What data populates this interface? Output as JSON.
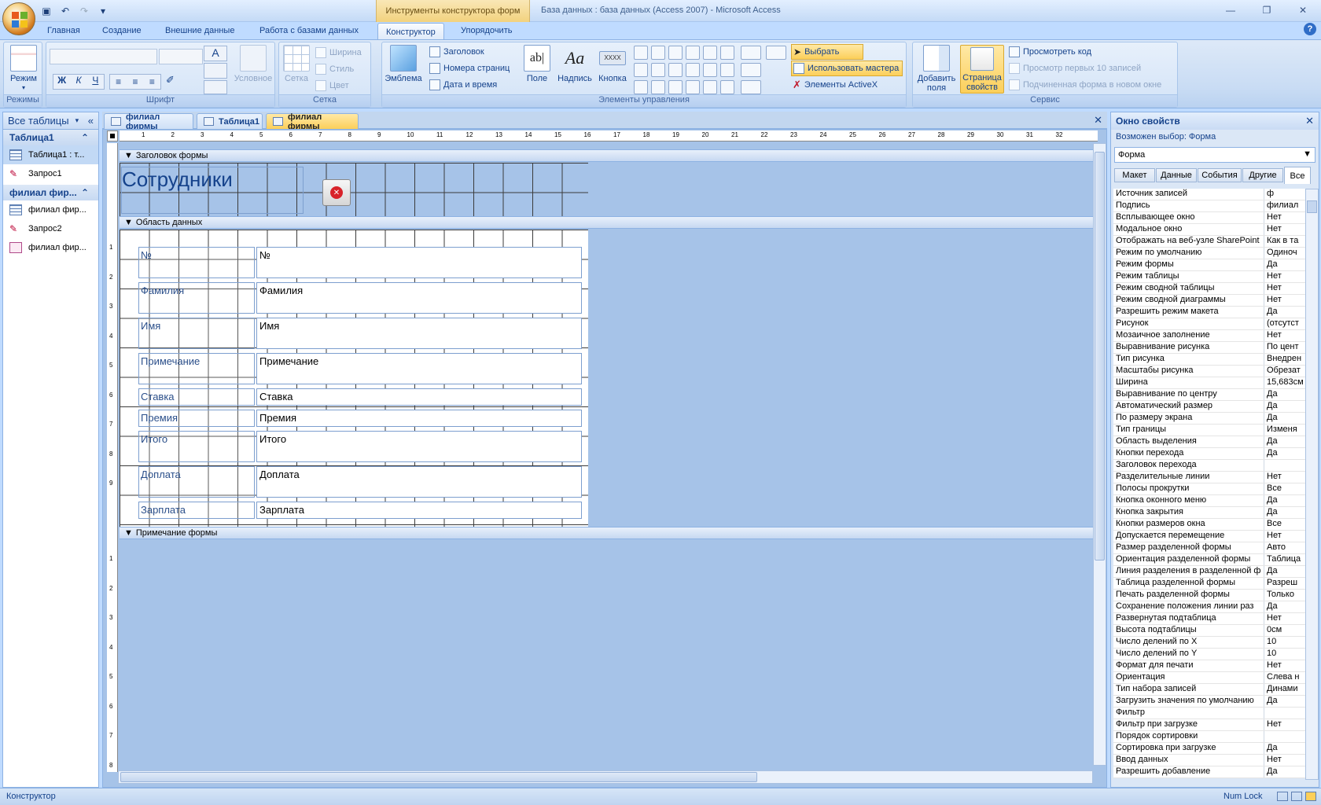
{
  "window": {
    "context_tab_title": "Инструменты конструктора форм",
    "title": "База данных : база данных (Access 2007) - Microsoft Access"
  },
  "ribbon_tabs": [
    "Главная",
    "Создание",
    "Внешние данные",
    "Работа с базами данных",
    "Конструктор",
    "Упорядочить"
  ],
  "ribbon": {
    "views_group": {
      "label": "Режимы",
      "mode_button": "Режим"
    },
    "font_group": {
      "label": "Шрифт",
      "bold": "Ж",
      "italic": "К",
      "underline": "Ч",
      "conditional": "Условное"
    },
    "grid_group": {
      "label": "Сетка",
      "grid_button": "Сетка",
      "width": "Ширина",
      "style": "Стиль",
      "color": "Цвет"
    },
    "controls_group": {
      "label": "Элементы управления",
      "logo": "Эмблема",
      "header": "Заголовок",
      "page_numbers": "Номера страниц",
      "date_time": "Дата и время",
      "field": "Поле",
      "field_icon": "ab|",
      "label_btn": "Надпись",
      "label_icon": "Aa",
      "button": "Кнопка",
      "button_icon": "XXXX",
      "select": "Выбрать",
      "use_wizards": "Использовать мастера",
      "activex": "Элементы ActiveX"
    },
    "tools_group": {
      "label": "Сервис",
      "add_fields": "Добавить поля",
      "property_sheet": "Страница свойств",
      "view_code": "Просмотреть код",
      "view_first10": "Просмотр первых 10 записей",
      "subform_new_window": "Подчиненная форма в новом окне"
    }
  },
  "nav": {
    "header": "Все таблицы",
    "groups": [
      {
        "title": "Таблица1",
        "items": [
          {
            "label": "Таблица1 : т...",
            "icon": "table-icon"
          },
          {
            "label": "Запрос1",
            "icon": "query-icon"
          }
        ]
      },
      {
        "title": "филиал фир...",
        "items": [
          {
            "label": "филиал фир...",
            "icon": "table-icon"
          },
          {
            "label": "Запрос2",
            "icon": "query-icon"
          },
          {
            "label": "филиал фир...",
            "icon": "form-icon"
          }
        ]
      }
    ]
  },
  "doc_tabs": [
    "филиал фирмы",
    "Таблица1",
    "филиал фирмы"
  ],
  "design": {
    "h_ruler": [
      "1",
      "2",
      "3",
      "4",
      "5",
      "6",
      "7",
      "8",
      "9",
      "10",
      "11",
      "12",
      "13",
      "14",
      "15",
      "16",
      "17",
      "18",
      "19",
      "20",
      "21",
      "22",
      "23",
      "24",
      "25",
      "26",
      "27",
      "28",
      "29",
      "30",
      "31",
      "32"
    ],
    "v_ruler_detail": [
      "1",
      "2",
      "3",
      "4",
      "5",
      "6",
      "7",
      "8",
      "9"
    ],
    "v_ruler_footer": [
      "1",
      "2",
      "3",
      "4",
      "5",
      "6",
      "7",
      "8"
    ],
    "header_section": "Заголовок формы",
    "detail_section": "Область данных",
    "footer_section": "Примечание формы",
    "form_title": "Сотрудники",
    "fields": [
      {
        "label": "№",
        "value": "№"
      },
      {
        "label": "Фамилия",
        "value": "Фамилия"
      },
      {
        "label": "Имя",
        "value": "Имя"
      },
      {
        "label": "Примечание",
        "value": "Примечание"
      },
      {
        "label": "Ставка",
        "value": "Ставка"
      },
      {
        "label": "Премия",
        "value": "Премия"
      },
      {
        "label": "Итого",
        "value": "Итого"
      },
      {
        "label": "Доплата",
        "value": "Доплата"
      },
      {
        "label": "Зарплата",
        "value": "Зарплата"
      }
    ]
  },
  "props": {
    "title": "Окно свойств",
    "selection_type": "Возможен выбор:  Форма",
    "object": "Форма",
    "tabs": [
      "Макет",
      "Данные",
      "События",
      "Другие",
      "Все"
    ],
    "rows": [
      [
        "Источник записей",
        "ф"
      ],
      [
        "Подпись",
        "филиал"
      ],
      [
        "Всплывающее окно",
        "Нет"
      ],
      [
        "Модальное окно",
        "Нет"
      ],
      [
        "Отображать на веб-узле SharePoint",
        "Как в та"
      ],
      [
        "Режим по умолчанию",
        "Одиноч"
      ],
      [
        "Режим формы",
        "Да"
      ],
      [
        "Режим таблицы",
        "Нет"
      ],
      [
        "Режим сводной таблицы",
        "Нет"
      ],
      [
        "Режим сводной диаграммы",
        "Нет"
      ],
      [
        "Разрешить режим макета",
        "Да"
      ],
      [
        "Рисунок",
        "(отсутст"
      ],
      [
        "Мозаичное заполнение",
        "Нет"
      ],
      [
        "Выравнивание рисунка",
        "По цент"
      ],
      [
        "Тип рисунка",
        "Внедрен"
      ],
      [
        "Масштабы рисунка",
        "Обрезат"
      ],
      [
        "Ширина",
        "15,683см"
      ],
      [
        "Выравнивание по центру",
        "Да"
      ],
      [
        "Автоматический размер",
        "Да"
      ],
      [
        "По размеру экрана",
        "Да"
      ],
      [
        "Тип границы",
        "Изменя"
      ],
      [
        "Область выделения",
        "Да"
      ],
      [
        "Кнопки перехода",
        "Да"
      ],
      [
        "Заголовок перехода",
        ""
      ],
      [
        "Разделительные линии",
        "Нет"
      ],
      [
        "Полосы прокрутки",
        "Все"
      ],
      [
        "Кнопка оконного меню",
        "Да"
      ],
      [
        "Кнопка закрытия",
        "Да"
      ],
      [
        "Кнопки размеров окна",
        "Все"
      ],
      [
        "Допускается перемещение",
        "Нет"
      ],
      [
        "Размер разделенной формы",
        "Авто"
      ],
      [
        "Ориентация разделенной формы",
        "Таблица"
      ],
      [
        "Линия разделения в разделенной ф",
        "Да"
      ],
      [
        "Таблица разделенной формы",
        "Разреш"
      ],
      [
        "Печать разделенной формы",
        "Только"
      ],
      [
        "Сохранение положения линии раз",
        "Да"
      ],
      [
        "Развернутая подтаблица",
        "Нет"
      ],
      [
        "Высота подтаблицы",
        "0см"
      ],
      [
        "Число делений по X",
        "10"
      ],
      [
        "Число делений по Y",
        "10"
      ],
      [
        "Формат для печати",
        "Нет"
      ],
      [
        "Ориентация",
        "Слева н"
      ],
      [
        "Тип набора записей",
        "Динами"
      ],
      [
        "Загрузить значения по умолчанию",
        "Да"
      ],
      [
        "Фильтр",
        ""
      ],
      [
        "Фильтр при загрузке",
        "Нет"
      ],
      [
        "Порядок сортировки",
        ""
      ],
      [
        "Сортировка при загрузке",
        "Да"
      ],
      [
        "Ввод данных",
        "Нет"
      ],
      [
        "Разрешить добавление",
        "Да"
      ]
    ]
  },
  "status": {
    "mode": "Конструктор",
    "numlock": "Num Lock"
  },
  "colors": {
    "accent": "#15428b",
    "ribbon": "#c9dcf4",
    "active_tab": "#fccf5a",
    "design_bg": "#a6c3e8"
  }
}
